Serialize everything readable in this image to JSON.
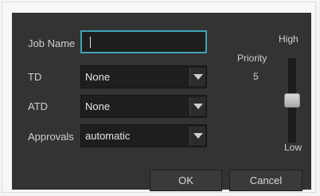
{
  "dialog": {
    "fields": {
      "job_name": {
        "label": "Job Name",
        "value": ""
      },
      "td": {
        "label": "TD",
        "value": "None"
      },
      "atd": {
        "label": "ATD",
        "value": "None"
      },
      "approvals": {
        "label": "Approvals",
        "value": "automatic"
      }
    },
    "priority": {
      "label": "Priority",
      "value": "5",
      "high_label": "High",
      "low_label": "Low",
      "level_fraction": 0.5
    },
    "buttons": {
      "ok": "OK",
      "cancel": "Cancel"
    }
  },
  "colors": {
    "dialog_bg": "#333333",
    "field_bg": "#1e1e1e",
    "focus_border": "#3fa3b8"
  }
}
